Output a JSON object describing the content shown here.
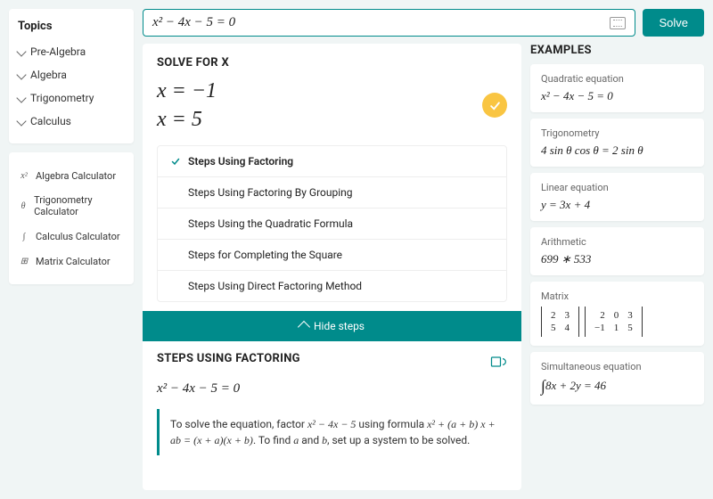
{
  "input": {
    "expression": "x² − 4x − 5 = 0",
    "solve_label": "Solve"
  },
  "sidebar": {
    "title": "Topics",
    "topics": [
      "Pre-Algebra",
      "Algebra",
      "Trigonometry",
      "Calculus"
    ],
    "calculators": [
      {
        "icon": "x²",
        "label": "Algebra Calculator"
      },
      {
        "icon": "θ",
        "label": "Trigonometry Calculator"
      },
      {
        "icon": "∫",
        "label": "Calculus Calculator"
      },
      {
        "icon": "⊞",
        "label": "Matrix Calculator"
      }
    ]
  },
  "solve": {
    "heading": "SOLVE FOR X",
    "solution_1": "x = −1",
    "solution_2": "x = 5",
    "steps": [
      "Steps Using Factoring",
      "Steps Using Factoring By Grouping",
      "Steps Using the Quadratic Formula",
      "Steps for Completing the Square",
      "Steps Using Direct Factoring Method"
    ],
    "hide_label": "Hide steps",
    "detail_heading": "STEPS USING FACTORING",
    "detail_equation": "x² − 4x − 5 = 0",
    "explain_pre": "To solve the equation, factor ",
    "explain_e1": "x² − 4x − 5",
    "explain_mid1": " using formula ",
    "explain_e2": "x² + (a + b) x + ab = (x + a)(x + b)",
    "explain_mid2": ". To find ",
    "explain_a": "a",
    "explain_and": " and ",
    "explain_b": "b",
    "explain_post": ", set up a system to be solved."
  },
  "examples": {
    "heading": "EXAMPLES",
    "items": [
      {
        "label": "Quadratic equation",
        "math": "x² − 4x − 5 = 0"
      },
      {
        "label": "Trigonometry",
        "math": "4 sin θ cos θ = 2 sin θ"
      },
      {
        "label": "Linear equation",
        "math": "y = 3x + 4"
      },
      {
        "label": "Arithmetic",
        "math": "699 ∗ 533"
      },
      {
        "label": "Matrix",
        "m1": [
          [
            2,
            3
          ],
          [
            5,
            4
          ]
        ],
        "m2": [
          [
            2,
            0,
            3
          ],
          [
            -1,
            1,
            5
          ]
        ]
      },
      {
        "label": "Simultaneous equation",
        "math": "8x + 2y = 46",
        "prefix": "∫"
      }
    ]
  }
}
